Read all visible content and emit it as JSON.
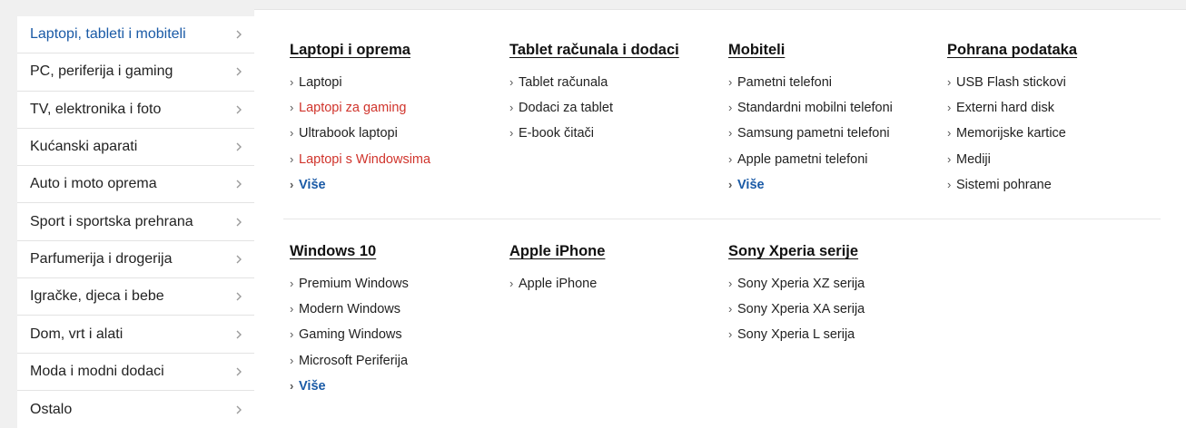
{
  "sidebar": {
    "items": [
      {
        "label": "Laptopi, tableti i mobiteli",
        "active": true
      },
      {
        "label": "PC, periferija i gaming"
      },
      {
        "label": "TV, elektronika i foto"
      },
      {
        "label": "Kućanski aparati"
      },
      {
        "label": "Auto i moto oprema"
      },
      {
        "label": "Sport i sportska prehrana"
      },
      {
        "label": "Parfumerija i drogerija"
      },
      {
        "label": "Igračke, djeca i bebe"
      },
      {
        "label": "Dom, vrt i alati"
      },
      {
        "label": "Moda i modni dodaci"
      },
      {
        "label": "Ostalo"
      }
    ],
    "chevron_icon": "chevron-right-icon"
  },
  "menu": {
    "link_arrow": "›",
    "row1": [
      {
        "title": "Laptopi i oprema",
        "links": [
          "Laptopi",
          "Laptopi za gaming",
          "Ultrabook laptopi",
          "Laptopi s Windowsima",
          "Više"
        ]
      },
      {
        "title": "Tablet računala i dodaci",
        "links": [
          "Tablet računala",
          "Dodaci za tablet",
          "E-book čitači"
        ]
      },
      {
        "title": "Mobiteli",
        "links": [
          "Pametni telefoni",
          "Standardni mobilni telefoni",
          "Samsung pametni telefoni",
          "Apple pametni telefoni",
          "Više"
        ]
      },
      {
        "title": "Pohrana podataka",
        "links": [
          "USB Flash stickovi",
          "Externi hard disk",
          "Memorijske kartice",
          "Mediji",
          "Sistemi pohrane"
        ]
      }
    ],
    "row2": [
      {
        "title": "Windows 10",
        "links": [
          "Premium Windows",
          "Modern Windows",
          "Gaming Windows",
          "Microsoft Periferija",
          "Više"
        ]
      },
      {
        "title": "Apple iPhone",
        "links": [
          "Apple iPhone"
        ]
      },
      {
        "title": "Sony Xperia serije",
        "links": [
          "Sony Xperia XZ serija",
          "Sony Xperia XA serija",
          "Sony Xperia L serija"
        ]
      }
    ]
  },
  "colors": {
    "accent_blue": "#1a5aa6",
    "promo_red": "#d0342c"
  }
}
